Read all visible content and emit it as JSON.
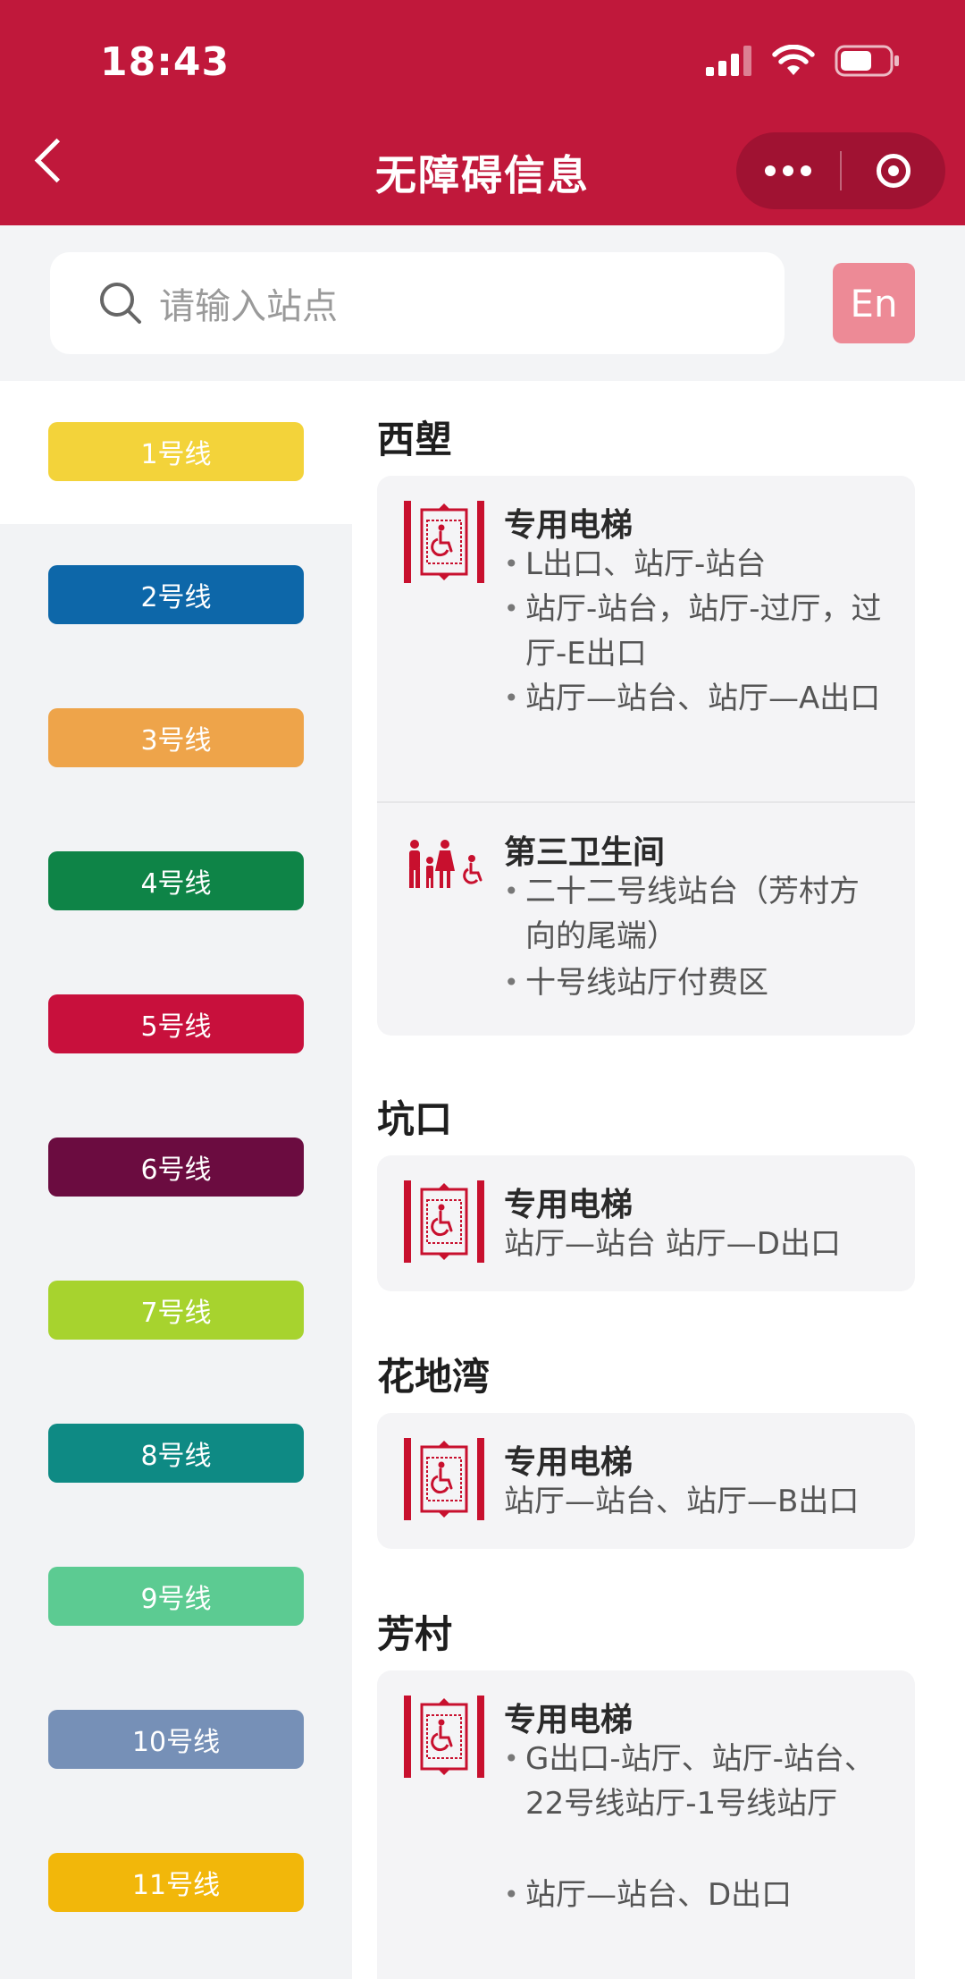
{
  "status": {
    "time": "18:43"
  },
  "nav": {
    "title": "无障碍信息"
  },
  "search": {
    "placeholder": "请输入站点"
  },
  "lang_button": "En",
  "lines": [
    {
      "label": "1号线",
      "color": "#f3d33a"
    },
    {
      "label": "2号线",
      "color": "#0d67a9"
    },
    {
      "label": "3号线",
      "color": "#eea44a"
    },
    {
      "label": "4号线",
      "color": "#0e8447"
    },
    {
      "label": "5号线",
      "color": "#c8103c"
    },
    {
      "label": "6号线",
      "color": "#6b0c40"
    },
    {
      "label": "7号线",
      "color": "#a7d32e"
    },
    {
      "label": "8号线",
      "color": "#0e8a84"
    },
    {
      "label": "9号线",
      "color": "#5ccb92"
    },
    {
      "label": "10号线",
      "color": "#7690b7"
    },
    {
      "label": "11号线",
      "color": "#f2b70a"
    }
  ],
  "stations": [
    {
      "name": "西塱",
      "facilities": [
        {
          "icon": "elevator-icon",
          "title": "专用电梯",
          "items": [
            "L出口、站厅-站台",
            "站厅-站台，站厅-过厅，过厅-E出口",
            "站厅—站台、站厅—A出口"
          ]
        },
        {
          "icon": "family-restroom-icon",
          "title": "第三卫生间",
          "items": [
            "二十二号线站台（芳村方向的尾端）",
            "十号线站厅付费区"
          ]
        }
      ]
    },
    {
      "name": "坑口",
      "facilities": [
        {
          "icon": "elevator-icon",
          "title": "专用电梯",
          "text": "站厅—站台 站厅—D出口"
        }
      ]
    },
    {
      "name": "花地湾",
      "facilities": [
        {
          "icon": "elevator-icon",
          "title": "专用电梯",
          "text": "站厅—站台、站厅—B出口"
        }
      ]
    },
    {
      "name": "芳村",
      "facilities": [
        {
          "icon": "elevator-icon",
          "title": "专用电梯",
          "items": [
            "G出口-站厅、站厅-站台、22号线站厅-1号线站厅",
            "站厅—站台、D出口"
          ]
        }
      ]
    }
  ]
}
